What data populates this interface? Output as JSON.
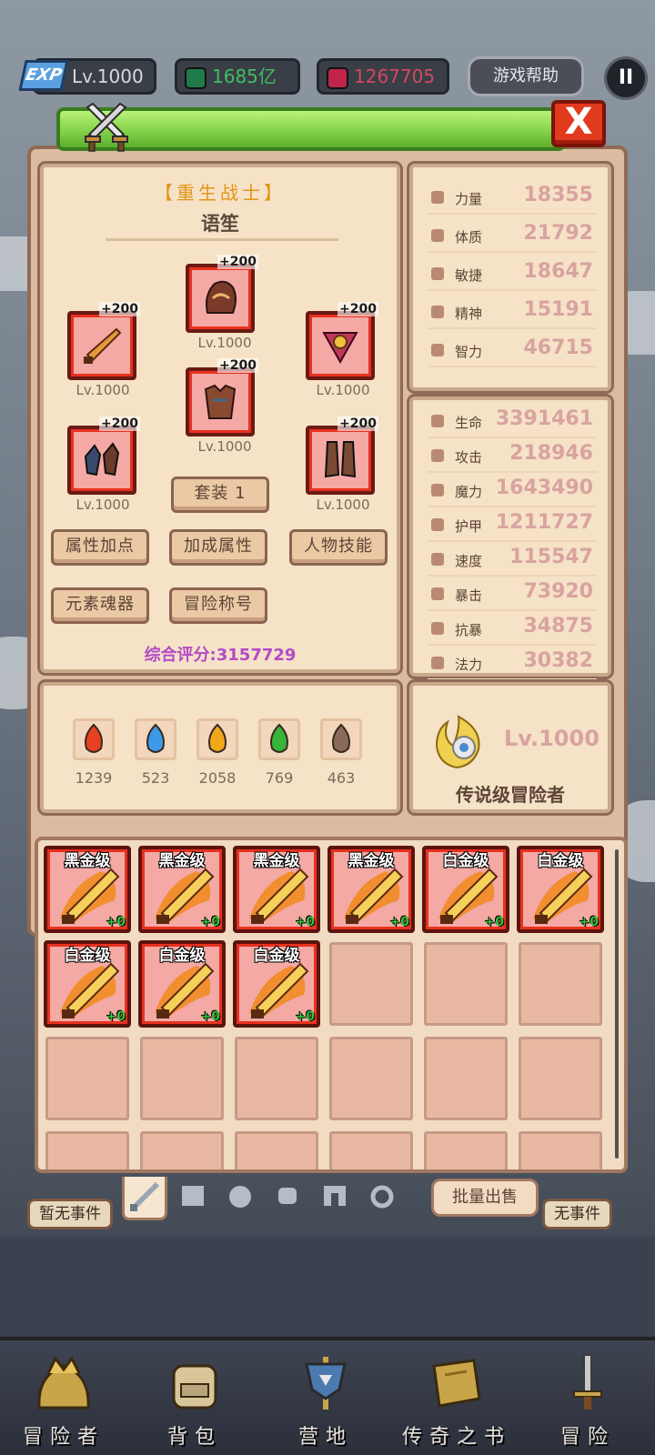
{
  "topbar": {
    "exp_badge": "EXP",
    "level": "Lv.1000",
    "green_currency": "1685亿",
    "red_currency": "1267705",
    "help_label": "游戏帮助",
    "pause_label": "II"
  },
  "dialog": {
    "close_label": "X"
  },
  "character": {
    "class_title": "【重生战士】",
    "name": "语笙",
    "equip_bonus": "+200",
    "equip_level": "Lv.1000",
    "set_button": "套装 1",
    "buttons": [
      "属性加点",
      "加成属性",
      "人物技能",
      "元素魂器",
      "冒险称号"
    ],
    "score": "综合评分:3157729"
  },
  "base_stats": [
    {
      "label": "力量",
      "value": "18355"
    },
    {
      "label": "体质",
      "value": "21792"
    },
    {
      "label": "敏捷",
      "value": "18647"
    },
    {
      "label": "精神",
      "value": "15191"
    },
    {
      "label": "智力",
      "value": "46715"
    }
  ],
  "combat_stats": [
    {
      "label": "生命",
      "value": "3391461"
    },
    {
      "label": "攻击",
      "value": "218946"
    },
    {
      "label": "魔力",
      "value": "1643490"
    },
    {
      "label": "护甲",
      "value": "1211727"
    },
    {
      "label": "速度",
      "value": "115547"
    },
    {
      "label": "暴击",
      "value": "73920"
    },
    {
      "label": "抗暴",
      "value": "34875"
    },
    {
      "label": "法力",
      "value": "30382"
    }
  ],
  "elements": [
    {
      "icon": "fire-icon",
      "value": "1239",
      "color": "#e8411f"
    },
    {
      "icon": "water-icon",
      "value": "523",
      "color": "#3c9be8"
    },
    {
      "icon": "lightning-icon",
      "value": "2058",
      "color": "#f0a81a"
    },
    {
      "icon": "leaf-icon",
      "value": "769",
      "color": "#37b43a"
    },
    {
      "icon": "skull-icon",
      "value": "463",
      "color": "#8a6a5a"
    }
  ],
  "rank": {
    "level": "Lv.1000",
    "title": "传说级冒险者"
  },
  "inventory": {
    "items": [
      {
        "grade": "黑金级",
        "enh": "+0"
      },
      {
        "grade": "黑金级",
        "enh": "+0"
      },
      {
        "grade": "黑金级",
        "enh": "+0"
      },
      {
        "grade": "黑金级",
        "enh": "+0"
      },
      {
        "grade": "白金级",
        "enh": "+0"
      },
      {
        "grade": "白金级",
        "enh": "+0"
      },
      {
        "grade": "白金级",
        "enh": "+0"
      },
      {
        "grade": "白金级",
        "enh": "+0"
      },
      {
        "grade": "白金级",
        "enh": "+0"
      }
    ],
    "batch_sell": "批量出售"
  },
  "world": {
    "event_left": "暂无事件",
    "event_right": "无事件"
  },
  "bottom_nav": [
    "冒险者",
    "背包",
    "营地",
    "传奇之书",
    "冒险"
  ]
}
